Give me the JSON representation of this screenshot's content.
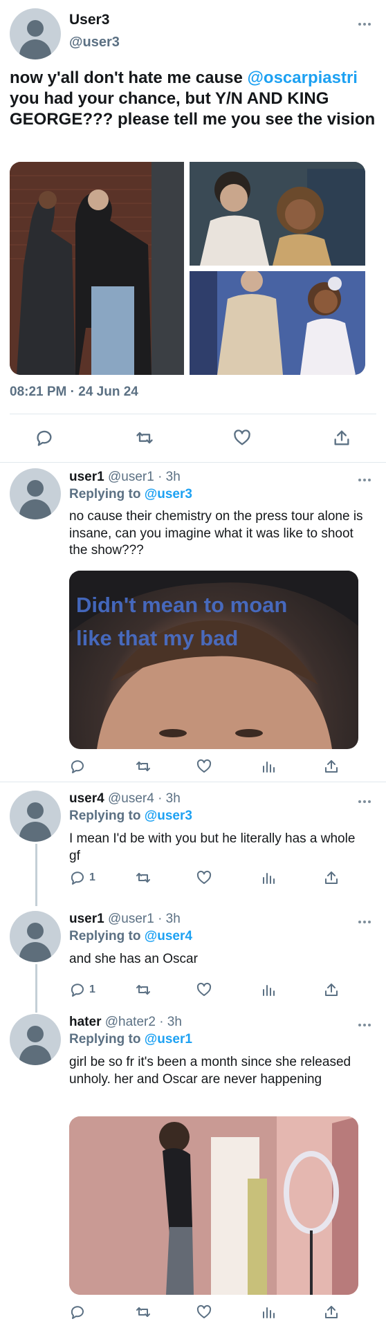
{
  "main": {
    "name": "User3",
    "handle": "@user3",
    "text_before": "now y'all don't hate me cause ",
    "mention": "@oscarpiastri",
    "text_after": " you had your chance, but Y/N AND KING GEORGE??? please tell me you see the vision",
    "timestamp": "08:21 PM · 24 Jun 24"
  },
  "replies": [
    {
      "name": "user1",
      "meta": " @user1 · 3h",
      "replying_label": "Replying to ",
      "replying_to": "@user3",
      "text": "no cause their chemistry on the press tour alone is insane, can you imagine what it was like to shoot the show???",
      "media_caption_1": "Didn't mean to moan",
      "media_caption_2": "like that my bad",
      "reply_count": ""
    },
    {
      "name": "user4",
      "meta": " @user4 · 3h",
      "replying_label": "Replying to ",
      "replying_to": "@user3",
      "text": "I mean I'd be with you but he literally has a whole gf",
      "reply_count": "1"
    },
    {
      "name": "user1",
      "meta": " @user1 · 3h",
      "replying_label": "Replying to ",
      "replying_to": "@user4",
      "text": "and she has an Oscar",
      "reply_count": "1"
    },
    {
      "name": "hater",
      "meta": " @hater2 · 3h",
      "replying_label": "Replying to ",
      "replying_to": "@user1",
      "text": "girl be so fr it's been a month since she released unholy. her and Oscar are never happening",
      "reply_count": ""
    }
  ],
  "icons": [
    "avatar-icon",
    "more-icon",
    "reply-icon",
    "retweet-icon",
    "like-icon",
    "analytics-icon",
    "share-icon"
  ],
  "colors": {
    "link": "#1da1f2",
    "secondary": "#5b7083",
    "divider": "#e1e8ed"
  }
}
